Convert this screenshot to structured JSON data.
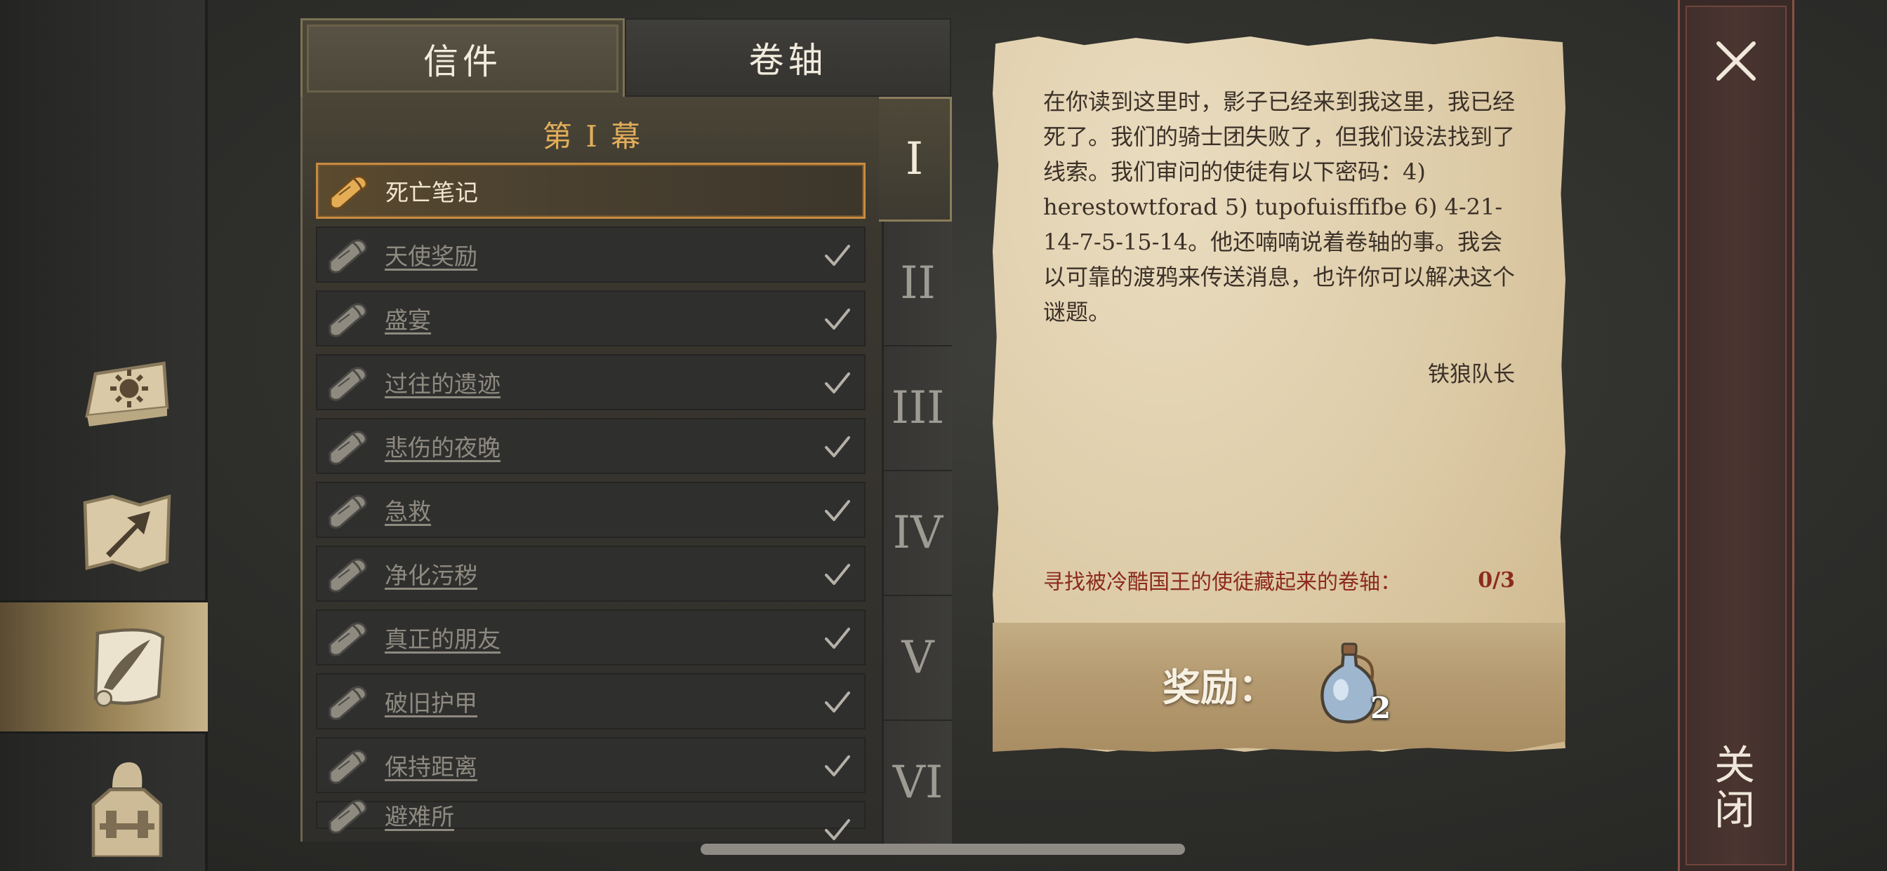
{
  "tabs": [
    {
      "label": "信件",
      "active": true
    },
    {
      "label": "卷轴",
      "active": false
    }
  ],
  "act_title": "第 I 幕",
  "quests": [
    {
      "label": "死亡笔记",
      "selected": true,
      "completed": false
    },
    {
      "label": "天使奖励",
      "selected": false,
      "completed": true
    },
    {
      "label": "盛宴",
      "selected": false,
      "completed": true
    },
    {
      "label": "过往的遗迹",
      "selected": false,
      "completed": true
    },
    {
      "label": "悲伤的夜晚",
      "selected": false,
      "completed": true
    },
    {
      "label": "急救",
      "selected": false,
      "completed": true
    },
    {
      "label": "净化污秽",
      "selected": false,
      "completed": true
    },
    {
      "label": "真正的朋友",
      "selected": false,
      "completed": true
    },
    {
      "label": "破旧护甲",
      "selected": false,
      "completed": true
    },
    {
      "label": "保持距离",
      "selected": false,
      "completed": true
    },
    {
      "label": "避难所",
      "selected": false,
      "completed": true
    }
  ],
  "acts": [
    {
      "label": "I",
      "active": true
    },
    {
      "label": "II",
      "active": false
    },
    {
      "label": "III",
      "active": false
    },
    {
      "label": "IV",
      "active": false
    },
    {
      "label": "V",
      "active": false
    },
    {
      "label": "VI",
      "active": false
    }
  ],
  "letter": {
    "body": "在你读到这里时，影子已经来到我这里，我已经死了。我们的骑士团失败了，但我们设法找到了线索。我们审问的使徒有以下密码：4) herestowtforad 5) tupofuisffifbe 6) 4-21-14-7-5-15-14。他还喃喃说着卷轴的事。我会以可靠的渡鸦来传送消息，也许你可以解决这个谜题。",
    "signature": "铁狼队长",
    "objective_text": "寻找被冷酷国王的使徒藏起来的卷轴：",
    "objective_count": "0/3",
    "reward_label": "奖励：",
    "reward_icon": "potion-flask-icon",
    "reward_qty": "2"
  },
  "close_label": "关闭",
  "sidebar": [
    {
      "icon": "sun-book-icon",
      "active": false
    },
    {
      "icon": "map-arrow-icon",
      "active": false
    },
    {
      "icon": "scroll-quill-icon",
      "active": true
    },
    {
      "icon": "character-armor-icon",
      "active": false
    }
  ],
  "colors": {
    "accent_gold": "#e2ad5a",
    "selected_border": "#c88b3e",
    "objective_red": "#8c2a1e",
    "close_border": "#8a5046"
  }
}
